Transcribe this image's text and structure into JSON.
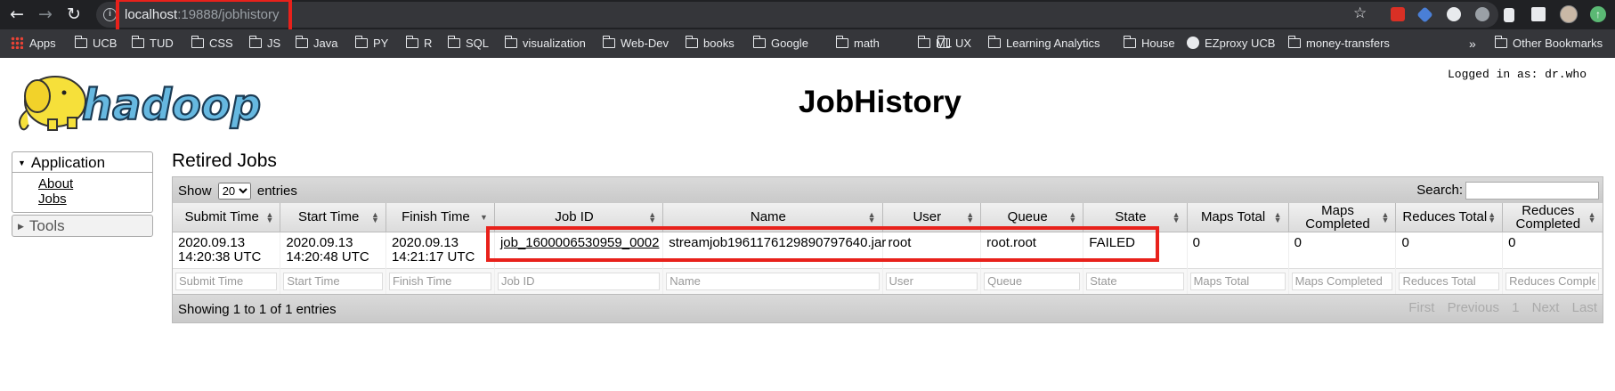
{
  "browser": {
    "url_host": "localhost",
    "url_path": ":19888/jobhistory",
    "info_icon": "i",
    "bookmarks": [
      "Apps",
      "UCB",
      "TUD",
      "CSS",
      "JS",
      "Java",
      "PY",
      "R",
      "SQL",
      "visualization",
      "Web-Dev",
      "books",
      "Google",
      "math",
      "ML",
      "UX",
      "Learning Analytics",
      "House",
      "EZproxy UCB",
      "money-transfers"
    ],
    "overflow": "»",
    "other_bookmarks": "Other Bookmarks"
  },
  "header": {
    "logo_text": "hadoop",
    "title": "JobHistory",
    "logged_in": "Logged in as: dr.who"
  },
  "sidebar": {
    "application": "Application",
    "links": [
      "About",
      "Jobs"
    ],
    "tools": "Tools"
  },
  "main": {
    "section_title": "Retired Jobs",
    "show_label": "Show",
    "page_size": "20",
    "entries_label": "entries",
    "search_label": "Search:",
    "columns": [
      "Submit Time",
      "Start Time",
      "Finish Time",
      "Job ID",
      "Name",
      "User",
      "Queue",
      "State",
      "Maps Total",
      "Maps Completed",
      "Reduces Total",
      "Reduces Completed"
    ],
    "rows": [
      {
        "submit_time": "2020.09.13 14:20:38 UTC",
        "start_time": "2020.09.13 14:20:48 UTC",
        "finish_time": "2020.09.13 14:21:17 UTC",
        "job_id": "job_1600006530959_0002",
        "name": "streamjob1961176129890797640.jar",
        "user": "root",
        "queue": "root.root",
        "state": "FAILED",
        "maps_total": "0",
        "maps_completed": "0",
        "reduces_total": "0",
        "reduces_completed": "0"
      }
    ],
    "filter_placeholders": [
      "Submit Time",
      "Start Time",
      "Finish Time",
      "Job ID",
      "Name",
      "User",
      "Queue",
      "State",
      "Maps Total",
      "Maps Completed",
      "Reduces Total",
      "Reduces Complet"
    ],
    "info": "Showing 1 to 1 of 1 entries",
    "pager": {
      "first": "First",
      "previous": "Previous",
      "page": "1",
      "next": "Next",
      "last": "Last"
    }
  },
  "colors": {
    "highlight": "#e8211b",
    "chrome_bg": "#202124",
    "bookmarks_bg": "#35363a"
  }
}
